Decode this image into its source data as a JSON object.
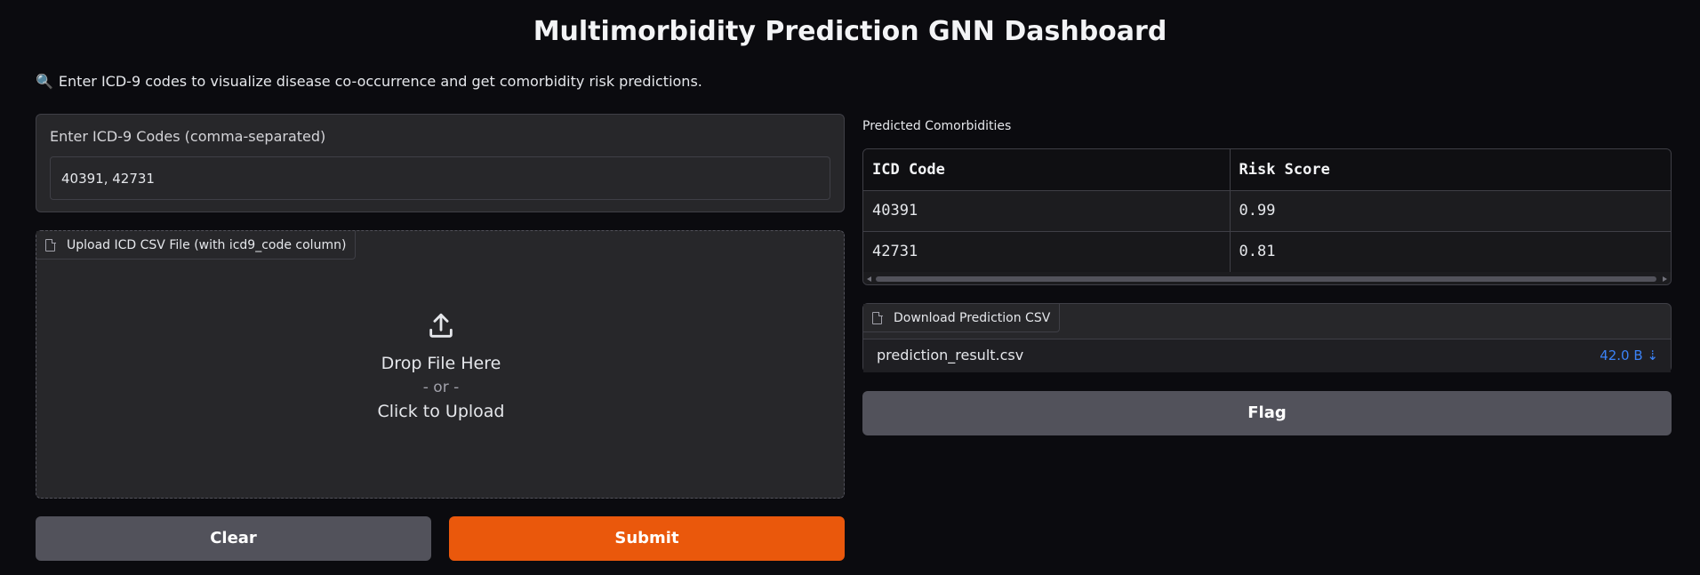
{
  "header": {
    "title": "Multimorbidity Prediction GNN Dashboard",
    "subtitle": "Enter ICD-9 codes to visualize disease co-occurrence and get comorbidity risk predictions.",
    "subtitle_icon": "magnifier-icon"
  },
  "codes_input": {
    "label": "Enter ICD-9 Codes (comma-separated)",
    "value": "40391, 42731"
  },
  "upload": {
    "label": "Upload ICD CSV File (with icd9_code column)",
    "drop_text": "Drop File Here",
    "or_text": "- or -",
    "click_text": "Click to Upload",
    "icon": "upload-icon"
  },
  "buttons": {
    "clear": "Clear",
    "submit": "Submit",
    "flag": "Flag"
  },
  "predictions": {
    "label": "Predicted Comorbidities",
    "columns": [
      "ICD Code",
      "Risk Score"
    ],
    "rows": [
      [
        "40391",
        "0.99"
      ],
      [
        "42731",
        "0.81"
      ]
    ]
  },
  "download": {
    "label": "Download Prediction CSV",
    "file_name": "prediction_result.csv",
    "file_size": "42.0 B ⇣"
  },
  "colors": {
    "background": "#0b0b0f",
    "panel": "#27272a",
    "submit": "#ea580c",
    "secondary_button": "#52525b",
    "link": "#3b82f6"
  }
}
